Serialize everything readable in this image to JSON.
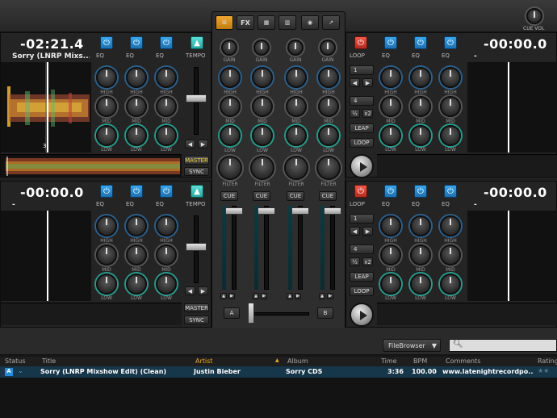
{
  "topbar": {
    "cue_vol_label": "CUE VOL"
  },
  "mixer_tabs": {
    "fx": "FX"
  },
  "decks": [
    {
      "time": "-02:21.4",
      "title": "Sorry (LNRP Mixs...",
      "beat_marker": "3",
      "tempo_label": "TEMPO",
      "eq_labels": [
        "EQ",
        "EQ",
        "EQ"
      ],
      "master": "MASTER",
      "sync": "SYNC"
    },
    {
      "time": "-00:00.0",
      "title": "-",
      "loop_label": "LOOP",
      "eq_labels": [
        "EQ",
        "EQ",
        "EQ"
      ],
      "loop_sizes": [
        "1",
        "4"
      ],
      "half": "½",
      "double": "x2",
      "leap": "LEAP",
      "loop": "LOOP"
    },
    {
      "time": "-00:00.0",
      "title": "-",
      "tempo_label": "TEMPO",
      "eq_labels": [
        "EQ",
        "EQ",
        "EQ"
      ],
      "master": "MASTER",
      "sync": "SYNC"
    },
    {
      "time": "-00:00.0",
      "title": "-",
      "loop_label": "LOOP",
      "eq_labels": [
        "EQ",
        "EQ",
        "EQ"
      ],
      "loop_sizes": [
        "1",
        "4"
      ],
      "half": "½",
      "double": "x2",
      "leap": "LEAP",
      "loop": "LOOP"
    }
  ],
  "knob_labels": {
    "high": "HIGH",
    "mid": "MID",
    "low": "LOW",
    "gain": "GAIN",
    "filter": "FILTER"
  },
  "mixer": {
    "cue": "CUE",
    "a": "A",
    "b": "B"
  },
  "browser": {
    "source": "FileBrowser",
    "columns": [
      "Status",
      "Title",
      "Artist",
      "Album",
      "Time",
      "BPM",
      "Comments",
      "Rating"
    ],
    "rows": [
      {
        "deck": "A",
        "title": "Sorry (LNRP Mixshow Edit) (Clean)",
        "artist": "Justin Bieber",
        "album": "Sorry CDS",
        "time": "3:36",
        "bpm": "100.00",
        "comments": "www.latenightrecordpo..."
      }
    ]
  },
  "colors": {
    "accent_blue": "#1d6fb0",
    "accent_teal": "#23a69e",
    "loop_red": "#b42a1e",
    "selected_row": "#16364a"
  }
}
